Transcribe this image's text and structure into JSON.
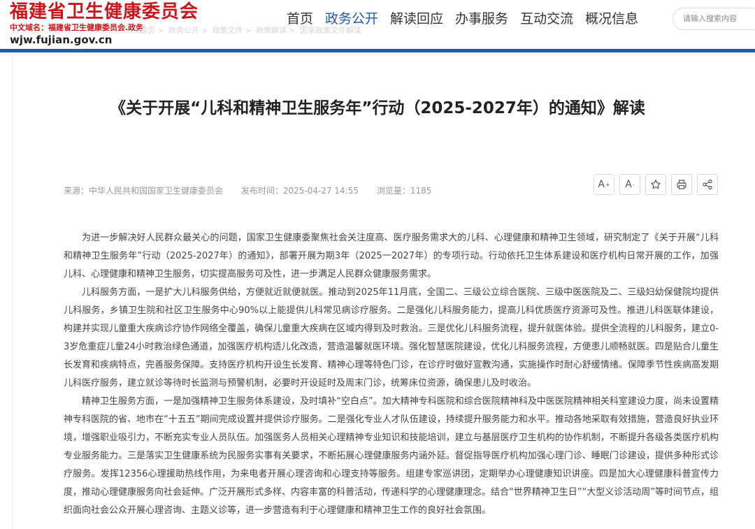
{
  "site": {
    "name": "福建省卫生健康委员会",
    "domain_label": "中文域名：福建省卫生健康委员会.政务",
    "url": "wjw.fujian.gov.cn"
  },
  "breadcrumb": [
    "首页",
    "政务公开",
    "政策文件",
    "政策解读",
    "国家政策文件解读"
  ],
  "nav": [
    {
      "label": "首页"
    },
    {
      "label": "政务公开"
    },
    {
      "label": "解读回应"
    },
    {
      "label": "办事服务"
    },
    {
      "label": "互动交流"
    },
    {
      "label": "概况信息"
    }
  ],
  "nav_active_index": 1,
  "search": {
    "placeholder": "请输入搜索内容"
  },
  "colors": {
    "brand_red": "#c8161d",
    "nav_blue": "#1f5aa8"
  },
  "article": {
    "title": "《关于开展“儿科和精神卫生服务年”行动（2025-2027年）的通知》解读",
    "source": "来源：中华人民共和国国家卫生健康委员会",
    "publish_time": "发布时间：2025-04-27 14:55",
    "views": "浏览量：1185",
    "tools": [
      {
        "label": "A",
        "sup": "+",
        "icon": "font-increase-icon"
      },
      {
        "label": "A",
        "sup": "-",
        "icon": "font-decrease-icon"
      },
      {
        "icon": "star-icon"
      },
      {
        "icon": "printer-icon"
      },
      {
        "icon": "share-icon"
      }
    ],
    "paragraphs": [
      "为进一步解决好人民群众最关心的问题，国家卫生健康委聚焦社会关注度高、医疗服务需求大的儿科、心理健康和精神卫生领域，研究制定了《关于开展“儿科和精神卫生服务年”行动（2025-2027年）的通知》，部署开展为期3年（2025一2027年）的专项行动。行动依托卫生体系建设和医疗机构日常开展的工作，加强儿科、心理健康和精神卫生服务，切实提高服务可及性，进一步满足人民群众健康服务需求。",
      "儿科服务方面，一是扩大儿科服务供给，方便就近就便就医。推动到2025年11月底，全国二、三级公立综合医院、三级中医医院及二、三级妇幼保健院均提供儿科服务，乡镇卫生院和社区卫生服务中心90%以上能提供儿科常见病诊疗服务。二是强化儿科服务能力，提高儿科优质医疗资源可及性。推进儿科医联体建设，构建并实现儿童重大疾病诊疗协作网络全覆盖，确保儿童重大疾病在区域内得到及时救治。三是优化儿科服务流程，提升就医体验。提供全流程的儿科服务，建立0-3岁危重症儿童24小时救治绿色通道，加强医疗机构适儿化改造，营造温馨就医环境。强化智慧医院建设，优化儿科服务流程，方便患儿顺畅就医。四是贴合儿童生长发育和疾病特点，完善服务保障。支持医疗机构开设生长发育、精神心理等特色门诊，在诊疗时做好宣教沟通，实施操作时耐心舒缓情绪。保障季节性疾病高发期儿科医疗服务，建立就诊等待时长监测与预警机制，必要时开设延时及周末门诊，统筹床位资源，确保患儿及时收治。",
      "精神卫生服务方面，一是加强精神卫生服务体系建设，及时填补“空白点”。加大精神专科医院和综合医院精神科及中医医院精神相关科室建设力度，尚未设置精神专科医院的省、地市在“十五五”期间完成设置并提供诊疗服务。二是强化专业人才队伍建设，持续提升服务能力和水平。推动各地采取有效措施，营造良好执业环境，增强职业吸引力，不断充实专业人员队伍。加强医务人员相关心理精神专业知识和技能培训，建立与基层医疗卫生机构的协作机制，不断提升各级各类医疗机构专业服务能力。三是落实卫生健康系统为民服务实事有关要求，不断拓展心理健康服务内涵外延。督促指导医疗机构加强心理门诊、睡眠门诊建设，提供多种形式诊疗服务。发挥12356心理援助热线作用，为来电者开展心理咨询和心理支持等服务。组建专家巡讲团，定期举办心理健康知识讲座。四是加大心理健康科普宣传力度，推动心理健康服务向社会延伸。广泛开展形式多样、内容丰富的科普活动，传递科学的心理健康理念。结合“世界精神卫生日”“大型义诊活动周”等时间节点，组织面向社会公众开展心理咨询、主题义诊等，进一步营造有利于心理健康和精神卫生工作的良好社会氛围。"
    ]
  }
}
